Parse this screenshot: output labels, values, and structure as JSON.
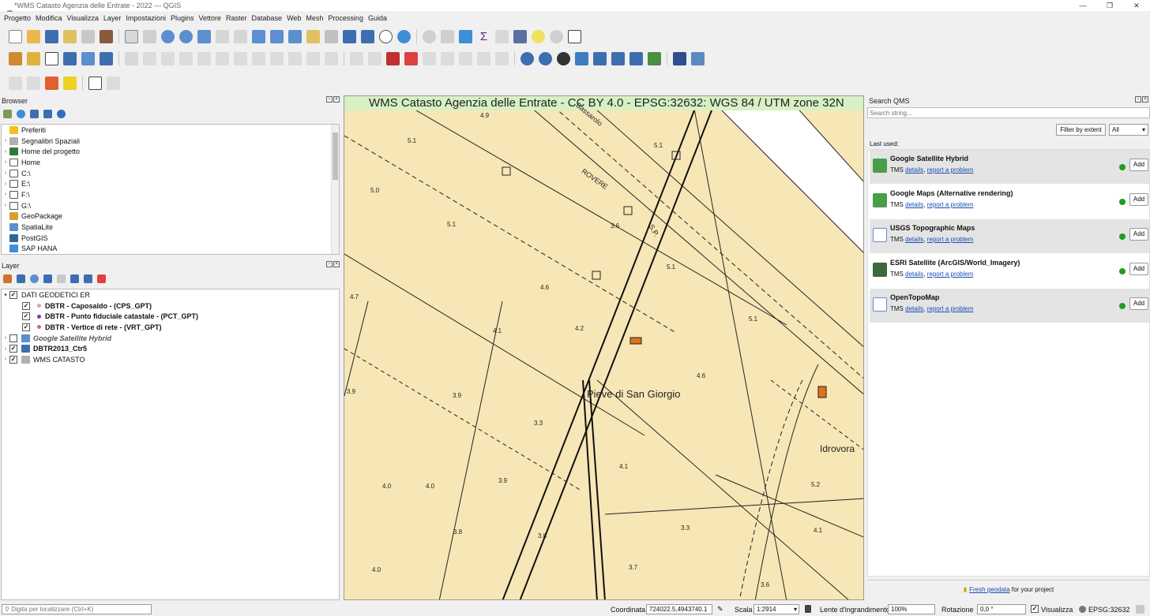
{
  "window": {
    "title": "*WMS Catasto Agenzia delle Entrate - 2022 — QGIS",
    "minimize": "—",
    "maximize": "❐",
    "close": "✕"
  },
  "menu": [
    "Progetto",
    "Modifica",
    "Visualizza",
    "Layer",
    "Impostazioni",
    "Plugins",
    "Vettore",
    "Raster",
    "Database",
    "Web",
    "Mesh",
    "Processing",
    "Guida"
  ],
  "browser": {
    "title": "Browser",
    "items": [
      {
        "label": "Preferiti",
        "icon": "star-icon"
      },
      {
        "label": "Segnalibri Spaziali",
        "icon": "bookmark-icon"
      },
      {
        "label": "Home del progetto",
        "icon": "project-home-icon"
      },
      {
        "label": "Home",
        "icon": "home-folder-icon"
      },
      {
        "label": "C:\\",
        "icon": "folder-icon"
      },
      {
        "label": "E:\\",
        "icon": "folder-icon"
      },
      {
        "label": "F:\\",
        "icon": "folder-icon"
      },
      {
        "label": "G:\\",
        "icon": "folder-icon"
      },
      {
        "label": "GeoPackage",
        "icon": "geopackage-icon"
      },
      {
        "label": "SpatiaLite",
        "icon": "spatialite-icon"
      },
      {
        "label": "PostGIS",
        "icon": "postgis-icon"
      },
      {
        "label": "SAP HANA",
        "icon": "saphana-icon"
      }
    ]
  },
  "layers": {
    "title": "Layer",
    "items": [
      {
        "label": "DATI GEODETICI ER",
        "checked": "✓",
        "expand": "▾"
      },
      {
        "label": "DBTR - Caposaldo - (CPS_GPT)",
        "checked": "✓",
        "dot": "#e0a0c0"
      },
      {
        "label": "DBTR - Punto fiduciale catastale - (PCT_GPT)",
        "checked": "✓",
        "dot": "#7b3fa0"
      },
      {
        "label": "DBTR - Vertice di rete - (VRT_GPT)",
        "checked": "✓",
        "dot": "#c07080"
      },
      {
        "label": "Google Satellite Hybrid",
        "checked": "",
        "expand": "›"
      },
      {
        "label": "DBTR2013_Ctr5",
        "checked": "✓",
        "expand": "›"
      },
      {
        "label": "WMS CATASTO",
        "checked": "✓",
        "expand": "›"
      }
    ]
  },
  "map": {
    "banner": "WMS Catasto Agenzia delle Entrate - CC BY 4.0 - EPSG:32632: WGS 84 / UTM zone 32N",
    "place_labels": [
      "Pieve di San Giorgio",
      "Idrovora",
      "ROVERE",
      "S.P.",
      "Bassarolo"
    ],
    "spot_heights": [
      "4.9",
      "5.1",
      "5.0",
      "5.1",
      "3.6",
      "4.6",
      "4.7",
      "4.2",
      "5.1",
      "5.1",
      "4.1",
      "4.6",
      "3.9",
      "3.9",
      "3.3",
      "4.0",
      "4.0",
      "3.8",
      "3.8",
      "4.0",
      "3.9",
      "4.1",
      "3.3",
      "3.7",
      "5.2",
      "4.1",
      "3.6",
      "5.1",
      "4.6",
      "5.1",
      "4.9"
    ]
  },
  "qms": {
    "title": "Search QMS",
    "search_placeholder": "Search string...",
    "filter_label": "Filter by extent",
    "filter_value": "All",
    "last_used": "Last used:",
    "items": [
      {
        "name": "Google Satellite Hybrid",
        "type": "TMS",
        "details": "details",
        "report": "report a problem",
        "add": "Add",
        "icon": "google-maps-icon"
      },
      {
        "name": "Google Maps (Alternative rendering)",
        "type": "TMS",
        "details": "details",
        "report": "report a problem",
        "add": "Add",
        "icon": "google-maps-icon"
      },
      {
        "name": "USGS Topographic Maps",
        "type": "TMS",
        "details": "details",
        "report": "report a problem",
        "add": "Add",
        "icon": "map-fold-icon"
      },
      {
        "name": "ESRI Satellite (ArcGIS/World_Imagery)",
        "type": "TMS",
        "details": "details",
        "report": "report a problem",
        "add": "Add",
        "icon": "esri-icon"
      },
      {
        "name": "OpenTopoMap",
        "type": "TMS",
        "details": "details",
        "report": "report a problem",
        "add": "Add",
        "icon": "map-fold-icon"
      }
    ],
    "footer_link": "Fresh geodata",
    "footer_text": " for your project"
  },
  "status": {
    "locate_placeholder": "Digita per localizzare (Ctrl+K)",
    "coord_label": "Coordinata",
    "coord_value": "724022.5,4943740.1",
    "scale_label": "Scala",
    "scale_value": "1:2914",
    "magnifier_label": "Lente d'ingrandimento",
    "magnifier_value": "100%",
    "rotation_label": "Rotazione",
    "rotation_value": "0,0 °",
    "render_label": "Visualizza",
    "crs": "EPSG:32632"
  },
  "colors": {
    "accent": "#1a4db5",
    "map_bg": "#f7e7b6",
    "banner_bg": "#d7f0c4",
    "ok": "#1e9e1e"
  }
}
